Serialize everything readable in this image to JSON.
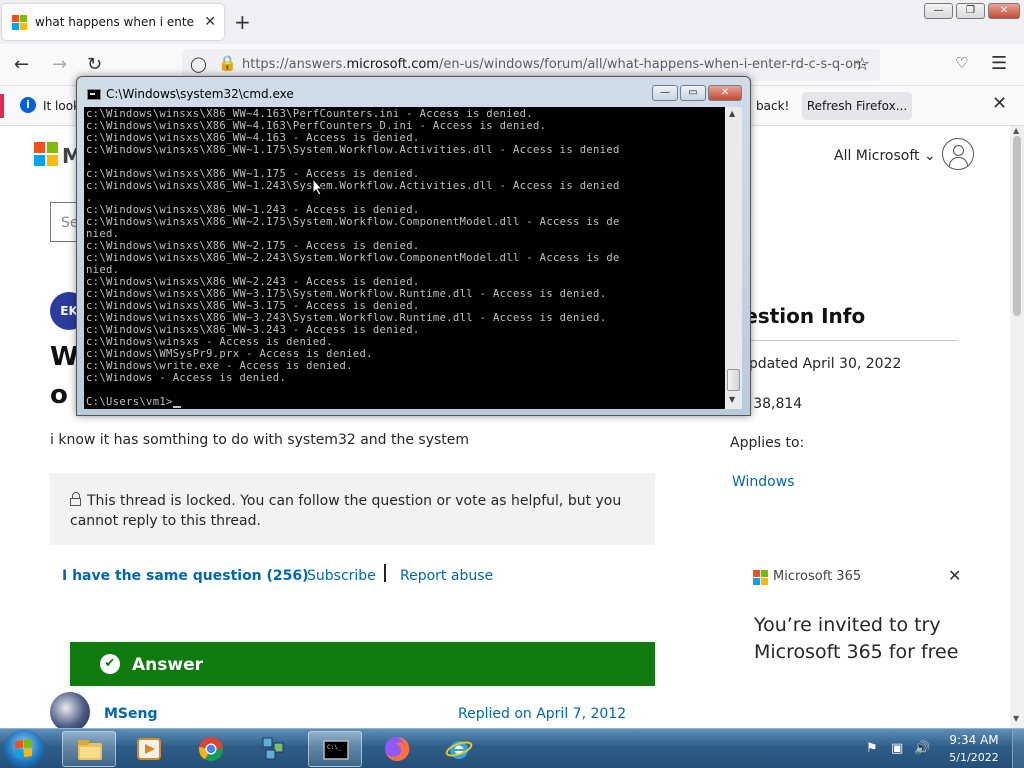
{
  "browser": {
    "tab_title": "what happens when i enter rd c",
    "tab_close": "✕",
    "new_tab": "+",
    "url_prefix": "https://answers.",
    "url_domain": "microsoft.com",
    "url_path": "/en-us/windows/forum/all/what-happens-when-i-enter-rd-c-s-q-on-",
    "infobar_text": "It look",
    "infobar_back": "back!",
    "refresh_label": "Refresh Firefox...",
    "window_buttons": {
      "minimize": "—",
      "restore": "❐",
      "close": "✕"
    }
  },
  "page": {
    "brand_letter": "M",
    "all_microsoft": "All Microsoft",
    "search_placeholder": "Se",
    "author_initials": "EK",
    "heading_line1": "W",
    "heading_line2": "o",
    "body": "i know it has somthing to do with system32 and the system",
    "locked_notice": "This thread is locked. You can follow the question or vote as helpful, but you cannot reply to this thread.",
    "same_question": "I have the same question (256)",
    "subscribe": "Subscribe",
    "report_abuse": "Report abuse",
    "answer_label": "Answer",
    "answerer": "MSeng",
    "replied": "Replied on April 7, 2012",
    "question_info": {
      "title": "uestion Info",
      "updated": "t updated April 30, 2022",
      "views": "ws 38,814",
      "applies_to": "Applies to:",
      "applies_value": "Windows"
    },
    "promo": {
      "brand": "Microsoft 365",
      "line1": "You’re invited to try",
      "line2": "Microsoft 365 for free",
      "close": "✕"
    }
  },
  "cmd": {
    "title": "C:\\Windows\\system32\\cmd.exe",
    "lines": [
      "c:\\Windows\\winsxs\\X86_WW~4.163\\PerfCounters.ini - Access is denied.",
      "c:\\Windows\\winsxs\\X86_WW~4.163\\PerfCounters_D.ini - Access is denied.",
      "c:\\Windows\\winsxs\\X86_WW~4.163 - Access is denied.",
      "c:\\Windows\\winsxs\\X86_WW~1.175\\System.Workflow.Activities.dll - Access is denied",
      ".",
      "c:\\Windows\\winsxs\\X86_WW~1.175 - Access is denied.",
      "c:\\Windows\\winsxs\\X86_WW~1.243\\System.Workflow.Activities.dll - Access is denied",
      ".",
      "c:\\Windows\\winsxs\\X86_WW~1.243 - Access is denied.",
      "c:\\Windows\\winsxs\\X86_WW~2.175\\System.Workflow.ComponentModel.dll - Access is de",
      "nied.",
      "c:\\Windows\\winsxs\\X86_WW~2.175 - Access is denied.",
      "c:\\Windows\\winsxs\\X86_WW~2.243\\System.Workflow.ComponentModel.dll - Access is de",
      "nied.",
      "c:\\Windows\\winsxs\\X86_WW~2.243 - Access is denied.",
      "c:\\Windows\\winsxs\\X86_WW~3.175\\System.Workflow.Runtime.dll - Access is denied.",
      "c:\\Windows\\winsxs\\X86_WW~3.175 - Access is denied.",
      "c:\\Windows\\winsxs\\X86_WW~3.243\\System.Workflow.Runtime.dll - Access is denied.",
      "c:\\Windows\\winsxs\\X86_WW~3.243 - Access is denied.",
      "c:\\Windows\\winsxs - Access is denied.",
      "c:\\Windows\\WMSysPr9.prx - Access is denied.",
      "c:\\Windows\\write.exe - Access is denied.",
      "c:\\Windows - Access is denied.",
      "",
      "C:\\Users\\vm1>"
    ],
    "window_buttons": {
      "minimize": "—",
      "restore": "▭",
      "close": "✕"
    }
  },
  "taskbar": {
    "time": "9:34 AM",
    "date": "5/1/2022",
    "apps": [
      "explorer",
      "media-player",
      "chrome",
      "network",
      "cmd",
      "firefox",
      "internet-explorer"
    ]
  },
  "colors": {
    "ms_red": "#f25022",
    "ms_green": "#7fba00",
    "ms_blue": "#00a4ef",
    "ms_yellow": "#ffb900",
    "link": "#0067b8",
    "answer_green": "#107c10"
  }
}
